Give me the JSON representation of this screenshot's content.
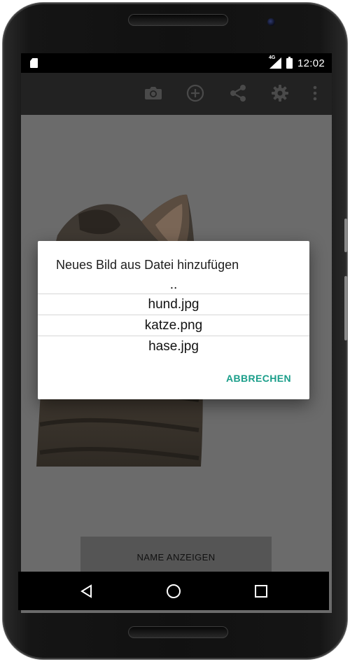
{
  "status_bar": {
    "network": "4G",
    "time": "12:02"
  },
  "toolbar": {
    "actions": [
      {
        "icon": "camera-icon"
      },
      {
        "icon": "add-circle-icon"
      },
      {
        "icon": "share-icon"
      },
      {
        "icon": "settings-icon"
      },
      {
        "icon": "more-vert-icon"
      }
    ]
  },
  "main": {
    "show_name_button": "NAME ANZEIGEN"
  },
  "dialog": {
    "title": "Neues Bild aus Datei hinzufügen",
    "items": [
      "..",
      "hund.jpg",
      "katze.png",
      "hase.jpg"
    ],
    "cancel_button": "ABBRECHEN"
  },
  "nav_bar": {
    "buttons": [
      "back-icon",
      "home-icon",
      "recents-icon"
    ]
  },
  "colors": {
    "accent": "#1a9e8a",
    "toolbar": "#222222",
    "scrim_content": "#6b6b6b"
  }
}
